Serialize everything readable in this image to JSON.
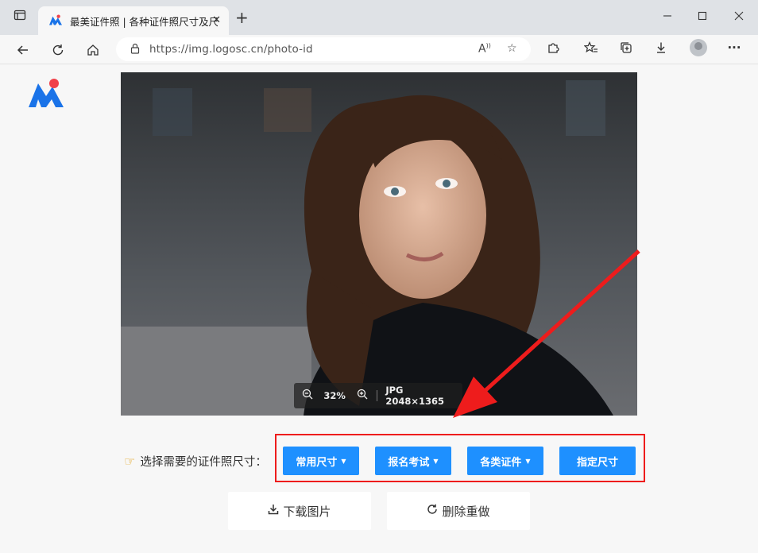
{
  "browser": {
    "tab_title": "最美证件照 | 各种证件照尺寸及尺",
    "url": "https://img.logosc.cn/photo-id",
    "icons": [
      "window-icon",
      "tab-favicon",
      "close-icon",
      "plus-icon",
      "minimize-icon",
      "maximize-icon",
      "back-icon",
      "refresh-icon",
      "home-icon",
      "lock-icon",
      "read-aloud-icon",
      "add-favorite-icon",
      "extensions-icon",
      "favorites-icon",
      "collections-icon",
      "downloads-icon",
      "profile-icon",
      "more-icon"
    ]
  },
  "viewer": {
    "zoom": "32%",
    "image_info": "JPG 2048×1365"
  },
  "size_picker": {
    "label": "选择需要的证件照尺寸：",
    "buttons": [
      {
        "label": "常用尺寸",
        "dropdown": true
      },
      {
        "label": "报名考试",
        "dropdown": true
      },
      {
        "label": "各类证件",
        "dropdown": true
      },
      {
        "label": "指定尺寸",
        "dropdown": false
      }
    ]
  },
  "actions": {
    "download": "下载图片",
    "redo": "删除重做"
  },
  "colors": {
    "accent_blue": "#1e90ff",
    "highlight_red": "#ee1c1c",
    "logo_blue": "#1a73e8",
    "logo_red": "#f0414a"
  }
}
